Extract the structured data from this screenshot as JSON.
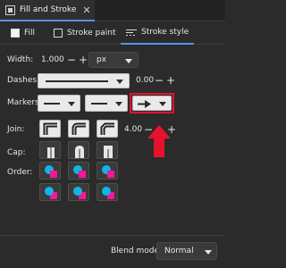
{
  "panel_tab": {
    "title": "Fill and Stroke",
    "close_glyph": "✕"
  },
  "subtabs": [
    {
      "label": "Fill"
    },
    {
      "label": "Stroke paint"
    },
    {
      "label": "Stroke style"
    }
  ],
  "width": {
    "label": "Width:",
    "value": "1.000",
    "minus": "−",
    "plus": "+",
    "unit": "px"
  },
  "dashes": {
    "label": "Dashes:",
    "value": "0.00",
    "minus": "−",
    "plus": "+"
  },
  "markers": {
    "label": "Markers:"
  },
  "join": {
    "label": "Join:",
    "miter_value": "4.00",
    "minus": "−",
    "plus": "+"
  },
  "cap": {
    "label": "Cap:"
  },
  "order": {
    "label": "Order:"
  },
  "footer": {
    "blend_label": "Blend mode:",
    "blend_value": "Normal"
  },
  "colors": {
    "accent": "#5d8fe8",
    "annotation_red": "#e8112d",
    "magenta": "#ff1493",
    "cyan": "#12b4e6"
  }
}
